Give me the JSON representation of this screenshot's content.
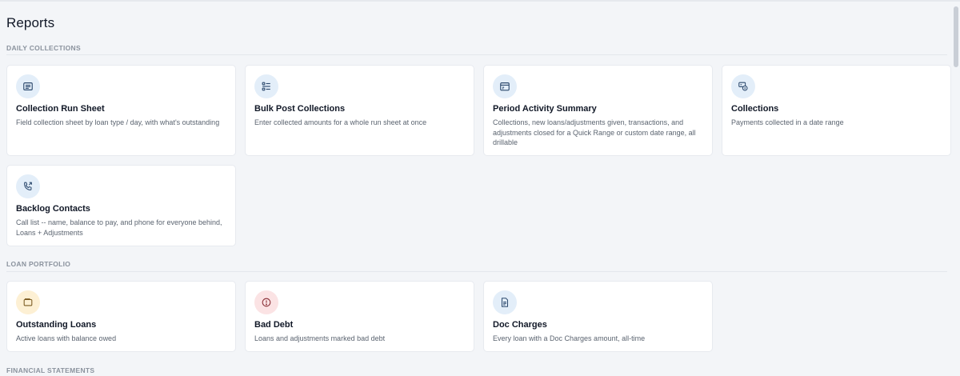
{
  "page": {
    "title": "Reports"
  },
  "sections": [
    {
      "label": "DAILY COLLECTIONS",
      "cards": [
        {
          "title": "Collection Run Sheet",
          "description": "Field collection sheet by loan type / day, with what's outstanding",
          "icon": "sheet-icon"
        },
        {
          "title": "Bulk Post Collections",
          "description": "Enter collected amounts for a whole run sheet at once",
          "icon": "checklist-icon"
        },
        {
          "title": "Period Activity Summary",
          "description": "Collections, new loans/adjustments given, transactions, and adjustments closed for a Quick Range or custom date range, all drillable",
          "icon": "calendar-icon"
        },
        {
          "title": "Collections",
          "description": "Payments collected in a date range",
          "icon": "collections-icon"
        },
        {
          "title": "Backlog Contacts",
          "description": "Call list -- name, balance to pay, and phone for everyone behind, Loans + Adjustments",
          "icon": "phone-icon"
        }
      ]
    },
    {
      "label": "LOAN PORTFOLIO",
      "cards": [
        {
          "title": "Outstanding Loans",
          "description": "Active loans with balance owed",
          "icon": "wallet-icon"
        },
        {
          "title": "Bad Debt",
          "description": "Loans and adjustments marked bad debt",
          "icon": "alert-circle-icon"
        },
        {
          "title": "Doc Charges",
          "description": "Every loan with a Doc Charges amount, all-time",
          "icon": "document-icon"
        }
      ]
    },
    {
      "label": "FINANCIAL STATEMENTS",
      "cards": []
    }
  ],
  "colors": {
    "background": "#f3f5f8",
    "card": "#ffffff",
    "icon_blue_bg": "#e3eef9",
    "icon_amber_bg": "#fdf0d4",
    "icon_red_bg": "#fbe3e4"
  }
}
